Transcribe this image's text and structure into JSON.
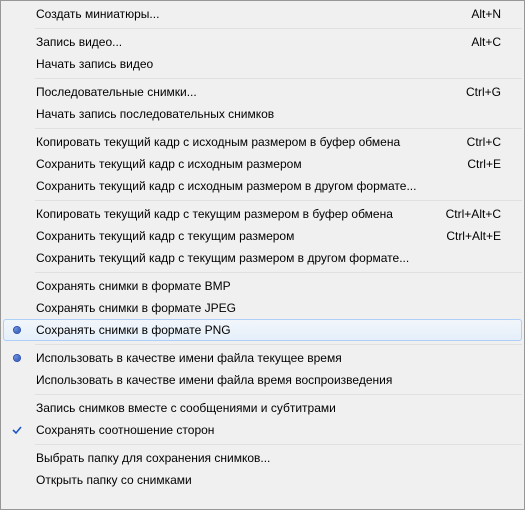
{
  "menu": {
    "items": [
      {
        "label": "Создать миниатюры...",
        "shortcut": "Alt+N"
      },
      {
        "sep": true
      },
      {
        "label": "Запись видео...",
        "shortcut": "Alt+C"
      },
      {
        "label": "Начать запись видео"
      },
      {
        "sep": true
      },
      {
        "label": "Последовательные снимки...",
        "shortcut": "Ctrl+G"
      },
      {
        "label": "Начать запись последовательных снимков"
      },
      {
        "sep": true
      },
      {
        "label": "Копировать текущий кадр с исходным размером в буфер обмена",
        "shortcut": "Ctrl+C"
      },
      {
        "label": "Сохранить текущий кадр с исходным размером",
        "shortcut": "Ctrl+E"
      },
      {
        "label": "Сохранить текущий кадр с исходным размером в другом формате..."
      },
      {
        "sep": true
      },
      {
        "label": "Копировать текущий кадр с текущим размером в буфер обмена",
        "shortcut": "Ctrl+Alt+C"
      },
      {
        "label": "Сохранить текущий кадр с текущим размером",
        "shortcut": "Ctrl+Alt+E"
      },
      {
        "label": "Сохранить текущий кадр с текущим размером в другом формате..."
      },
      {
        "sep": true
      },
      {
        "label": "Сохранять снимки в формате BMP"
      },
      {
        "label": "Сохранять снимки в формате JPEG"
      },
      {
        "label": "Сохранять снимки в формате PNG",
        "radio": true,
        "highlighted": true
      },
      {
        "sep": true
      },
      {
        "label": "Использовать в качестве имени файла текущее время",
        "radio": true
      },
      {
        "label": "Использовать в качестве имени файла время воспроизведения"
      },
      {
        "sep": true
      },
      {
        "label": "Запись снимков вместе с сообщениями и субтитрами"
      },
      {
        "label": "Сохранять соотношение сторон",
        "check": true
      },
      {
        "sep": true
      },
      {
        "label": "Выбрать папку для сохранения снимков..."
      },
      {
        "label": "Открыть папку со снимками"
      }
    ]
  }
}
